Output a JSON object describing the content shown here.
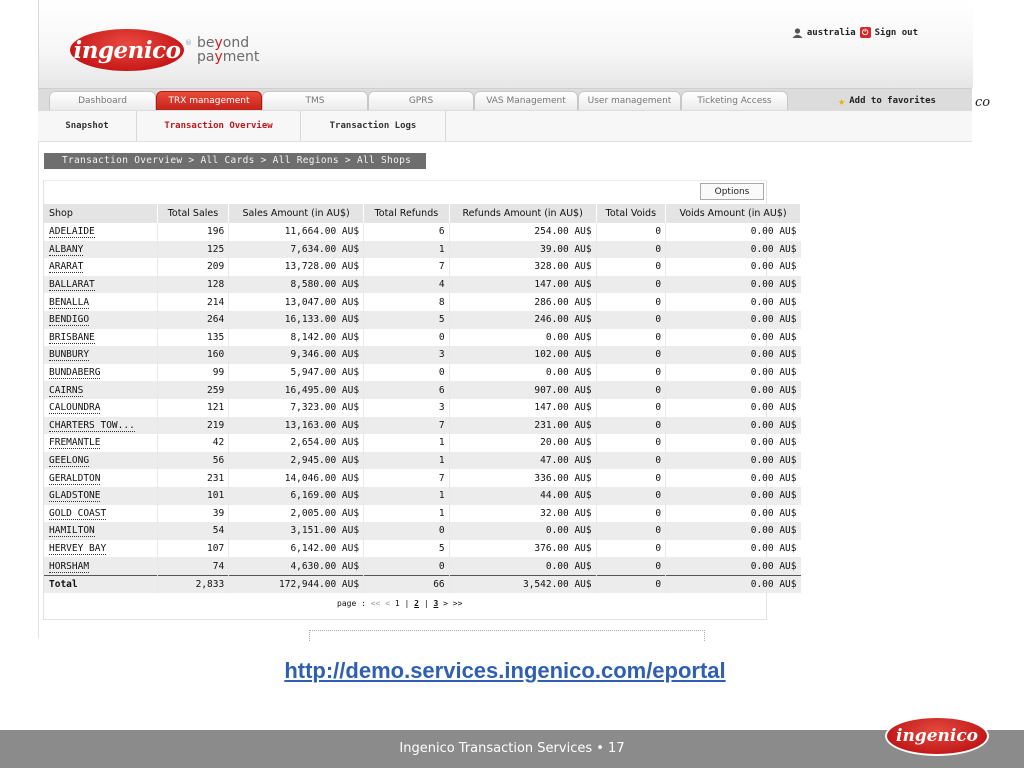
{
  "brand": {
    "logo_text": "ingenico",
    "registered_mark": "®",
    "tagline_line1_pre": "be",
    "tagline_line1_y": "y",
    "tagline_line1_post": "ond",
    "tagline_line2_pre": "pa",
    "tagline_line2_y": "y",
    "tagline_line2_post": "ment",
    "primary_color": "#c8191a"
  },
  "user": {
    "name": "australia",
    "signout_label": "Sign out",
    "user_icon": "user-icon",
    "signout_icon": "power-icon"
  },
  "tabs": [
    {
      "label": "Dashboard",
      "active": false
    },
    {
      "label": "TRX management",
      "active": true
    },
    {
      "label": "TMS",
      "active": false
    },
    {
      "label": "GPRS",
      "active": false
    },
    {
      "label": "VAS Management",
      "active": false
    },
    {
      "label": "User management",
      "active": false
    },
    {
      "label": "Ticketing Access",
      "active": false
    }
  ],
  "favorites": {
    "label": "Add to favorites",
    "icon": "star-icon"
  },
  "stray_text": "co",
  "subnav": [
    {
      "label": "Snapshot",
      "active": false
    },
    {
      "label": "Transaction Overview",
      "active": true
    },
    {
      "label": "Transaction Logs",
      "active": false
    }
  ],
  "breadcrumb": "Transaction Overview > All Cards > All Regions > All Shops",
  "options_label": "Options",
  "table": {
    "columns": [
      "Shop",
      "Total Sales",
      "Sales Amount (in AU$)",
      "Total Refunds",
      "Refunds Amount (in AU$)",
      "Total Voids",
      "Voids Amount (in AU$)"
    ],
    "rows": [
      [
        "ADELAIDE",
        "196",
        "11,664.00 AU$",
        "6",
        "254.00 AU$",
        "0",
        "0.00 AU$"
      ],
      [
        "ALBANY",
        "125",
        "7,634.00 AU$",
        "1",
        "39.00 AU$",
        "0",
        "0.00 AU$"
      ],
      [
        "ARARAT",
        "209",
        "13,728.00 AU$",
        "7",
        "328.00 AU$",
        "0",
        "0.00 AU$"
      ],
      [
        "BALLARAT",
        "128",
        "8,580.00 AU$",
        "4",
        "147.00 AU$",
        "0",
        "0.00 AU$"
      ],
      [
        "BENALLA",
        "214",
        "13,047.00 AU$",
        "8",
        "286.00 AU$",
        "0",
        "0.00 AU$"
      ],
      [
        "BENDIGO",
        "264",
        "16,133.00 AU$",
        "5",
        "246.00 AU$",
        "0",
        "0.00 AU$"
      ],
      [
        "BRISBANE",
        "135",
        "8,142.00 AU$",
        "0",
        "0.00 AU$",
        "0",
        "0.00 AU$"
      ],
      [
        "BUNBURY",
        "160",
        "9,346.00 AU$",
        "3",
        "102.00 AU$",
        "0",
        "0.00 AU$"
      ],
      [
        "BUNDABERG",
        "99",
        "5,947.00 AU$",
        "0",
        "0.00 AU$",
        "0",
        "0.00 AU$"
      ],
      [
        "CAIRNS",
        "259",
        "16,495.00 AU$",
        "6",
        "907.00 AU$",
        "0",
        "0.00 AU$"
      ],
      [
        "CALOUNDRA",
        "121",
        "7,323.00 AU$",
        "3",
        "147.00 AU$",
        "0",
        "0.00 AU$"
      ],
      [
        "CHARTERS TOW...",
        "219",
        "13,163.00 AU$",
        "7",
        "231.00 AU$",
        "0",
        "0.00 AU$"
      ],
      [
        "FREMANTLE",
        "42",
        "2,654.00 AU$",
        "1",
        "20.00 AU$",
        "0",
        "0.00 AU$"
      ],
      [
        "GEELONG",
        "56",
        "2,945.00 AU$",
        "1",
        "47.00 AU$",
        "0",
        "0.00 AU$"
      ],
      [
        "GERALDTON",
        "231",
        "14,046.00 AU$",
        "7",
        "336.00 AU$",
        "0",
        "0.00 AU$"
      ],
      [
        "GLADSTONE",
        "101",
        "6,169.00 AU$",
        "1",
        "44.00 AU$",
        "0",
        "0.00 AU$"
      ],
      [
        "GOLD COAST",
        "39",
        "2,005.00 AU$",
        "1",
        "32.00 AU$",
        "0",
        "0.00 AU$"
      ],
      [
        "HAMILTON",
        "54",
        "3,151.00 AU$",
        "0",
        "0.00 AU$",
        "0",
        "0.00 AU$"
      ],
      [
        "HERVEY BAY",
        "107",
        "6,142.00 AU$",
        "5",
        "376.00 AU$",
        "0",
        "0.00 AU$"
      ],
      [
        "HORSHAM",
        "74",
        "4,630.00 AU$",
        "0",
        "0.00 AU$",
        "0",
        "0.00 AU$"
      ]
    ],
    "total": [
      "Total",
      "2,833",
      "172,944.00 AU$",
      "66",
      "3,542.00 AU$",
      "0",
      "0.00 AU$"
    ]
  },
  "pager": {
    "label": "page :",
    "first": "<<",
    "prev": "<",
    "pages": [
      "1",
      "2",
      "3"
    ],
    "separator": "|",
    "next": ">",
    "last": ">>"
  },
  "url": "http://demo.services.ingenico.com/eportal",
  "footer": {
    "text": "Ingenico Transaction Services • 17",
    "logo_text": "ingenico"
  }
}
